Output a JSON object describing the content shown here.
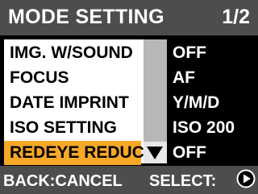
{
  "header": {
    "title": "MODE SETTING",
    "page": "1/2"
  },
  "menu": {
    "items": [
      {
        "label": "IMG. W/SOUND",
        "value": "OFF"
      },
      {
        "label": "FOCUS",
        "value": "AF"
      },
      {
        "label": "DATE IMPRINT",
        "value": "Y/M/D"
      },
      {
        "label": "ISO SETTING",
        "value": "ISO 200"
      },
      {
        "label": "REDEYE REDUC",
        "value": "OFF",
        "selected": true
      }
    ]
  },
  "footer": {
    "back_label": "BACK:CANCEL",
    "select_label": "SELECT:"
  },
  "colors": {
    "header_bg": "#4d4d4d",
    "selection": "#f7a827",
    "panel": "#ffffff",
    "scroll_thumb": "#b7b7b7"
  },
  "icons": {
    "scroll_down": "triangle-down-icon",
    "select_button": "play-circle-icon"
  }
}
